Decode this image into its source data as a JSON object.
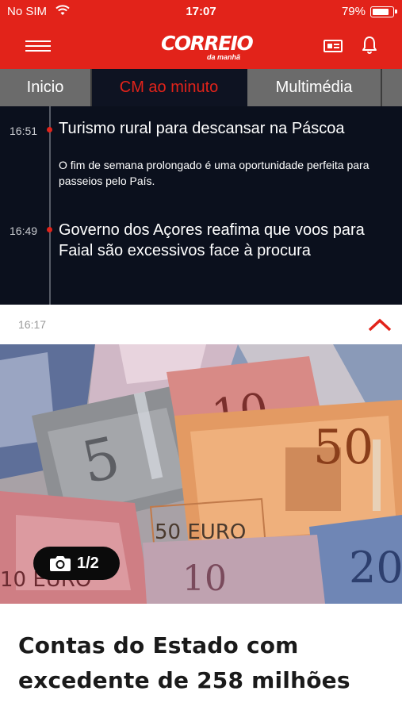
{
  "status_bar": {
    "carrier": "No SIM",
    "time": "17:07",
    "battery": "79%"
  },
  "header": {
    "logo_main": "CORREIO",
    "logo_sub": "da manhã",
    "icons": {
      "menu": "hamburger-icon",
      "newspaper": "newspaper-icon",
      "notifications": "bell-icon"
    }
  },
  "tabs": [
    {
      "label": "Inicio",
      "active": false
    },
    {
      "label": "CM ao minuto",
      "active": true
    },
    {
      "label": "Multimédia",
      "active": false
    },
    {
      "label": "",
      "active": false
    }
  ],
  "feed": [
    {
      "time": "16:51",
      "headline": "Turismo rural para descansar na Páscoa",
      "summary": "O fim de semana prolongado é uma oportunidade perfeita para passeios pelo País."
    },
    {
      "time": "16:49",
      "headline": "Governo dos Açores reafima que voos para Faial são excessivos face à procura",
      "summary": ""
    }
  ],
  "article": {
    "time": "16:17",
    "photo_counter": "1/2",
    "title": "Contas do Estado com excedente de 258 milhões"
  },
  "colors": {
    "brand_red": "#e2231a",
    "feed_background": "#0b101d",
    "tab_inactive": "#6b6b6b"
  }
}
